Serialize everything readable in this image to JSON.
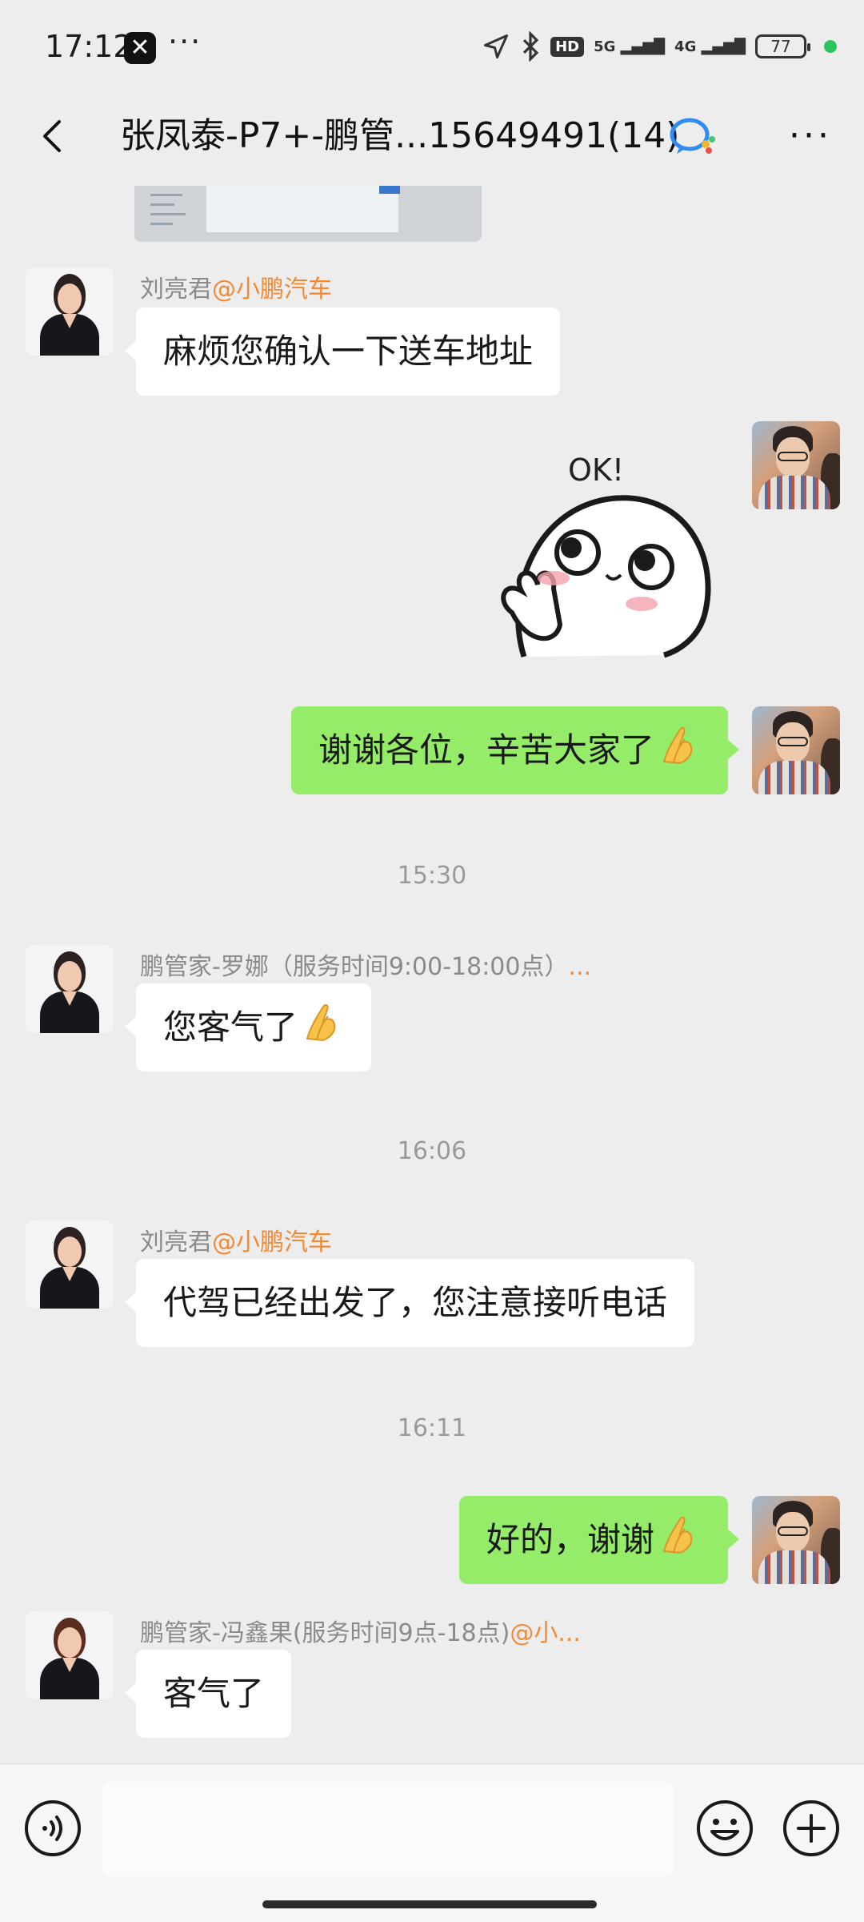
{
  "status_bar": {
    "time": "17:12",
    "more": "···",
    "hd": "HD",
    "net1": "5G",
    "net2": "4G",
    "battery": "77"
  },
  "header": {
    "title": "张凤泰-P7+-鹏管...15649491(14)",
    "menu": "···"
  },
  "messages": [
    {
      "sender": "刘亮君",
      "sender_tag": "@小鹏汽车",
      "text": "麻烦您确认一下送车地址"
    },
    {
      "sticker_text": "OK!"
    },
    {
      "text": "谢谢各位，辛苦大家了"
    },
    {
      "time": "15:30"
    },
    {
      "sender": "鹏管家-罗娜（服务时间9:00-18:00点）",
      "sender_tag": "...",
      "text": "您客气了"
    },
    {
      "time": "16:06"
    },
    {
      "sender": "刘亮君",
      "sender_tag": "@小鹏汽车",
      "text": "代驾已经出发了，您注意接听电话"
    },
    {
      "time": "16:11"
    },
    {
      "text": "好的，谢谢"
    },
    {
      "sender": "鹏管家-冯鑫果(服务时间9点-18点)",
      "sender_tag": "@小...",
      "text": "客气了"
    }
  ],
  "input": {
    "value": ""
  },
  "colors": {
    "background": "#ededed",
    "bubble_out": "#95ec69",
    "bubble_in": "#ffffff",
    "sender_tag": "#f08a35"
  }
}
